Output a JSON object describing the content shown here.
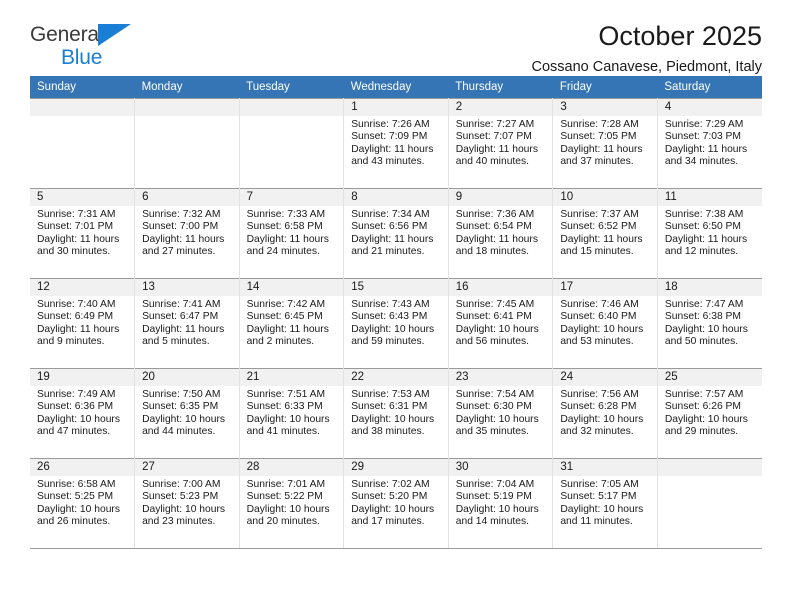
{
  "brand": {
    "name_line1": "General",
    "name_line2": "Blue",
    "accent_color": "#1a7fd4"
  },
  "header": {
    "title": "October 2025",
    "subtitle": "Cossano Canavese, Piedmont, Italy"
  },
  "calendar": {
    "header_bg": "#3575b5",
    "daynum_bg": "#f1f1f1",
    "weekdays": [
      "Sunday",
      "Monday",
      "Tuesday",
      "Wednesday",
      "Thursday",
      "Friday",
      "Saturday"
    ],
    "weeks": [
      [
        {
          "day": "",
          "empty": true
        },
        {
          "day": "",
          "empty": true
        },
        {
          "day": "",
          "empty": true
        },
        {
          "day": "1",
          "sunrise": "Sunrise: 7:26 AM",
          "sunset": "Sunset: 7:09 PM",
          "daylight1": "Daylight: 11 hours",
          "daylight2": "and 43 minutes."
        },
        {
          "day": "2",
          "sunrise": "Sunrise: 7:27 AM",
          "sunset": "Sunset: 7:07 PM",
          "daylight1": "Daylight: 11 hours",
          "daylight2": "and 40 minutes."
        },
        {
          "day": "3",
          "sunrise": "Sunrise: 7:28 AM",
          "sunset": "Sunset: 7:05 PM",
          "daylight1": "Daylight: 11 hours",
          "daylight2": "and 37 minutes."
        },
        {
          "day": "4",
          "sunrise": "Sunrise: 7:29 AM",
          "sunset": "Sunset: 7:03 PM",
          "daylight1": "Daylight: 11 hours",
          "daylight2": "and 34 minutes."
        }
      ],
      [
        {
          "day": "5",
          "sunrise": "Sunrise: 7:31 AM",
          "sunset": "Sunset: 7:01 PM",
          "daylight1": "Daylight: 11 hours",
          "daylight2": "and 30 minutes."
        },
        {
          "day": "6",
          "sunrise": "Sunrise: 7:32 AM",
          "sunset": "Sunset: 7:00 PM",
          "daylight1": "Daylight: 11 hours",
          "daylight2": "and 27 minutes."
        },
        {
          "day": "7",
          "sunrise": "Sunrise: 7:33 AM",
          "sunset": "Sunset: 6:58 PM",
          "daylight1": "Daylight: 11 hours",
          "daylight2": "and 24 minutes."
        },
        {
          "day": "8",
          "sunrise": "Sunrise: 7:34 AM",
          "sunset": "Sunset: 6:56 PM",
          "daylight1": "Daylight: 11 hours",
          "daylight2": "and 21 minutes."
        },
        {
          "day": "9",
          "sunrise": "Sunrise: 7:36 AM",
          "sunset": "Sunset: 6:54 PM",
          "daylight1": "Daylight: 11 hours",
          "daylight2": "and 18 minutes."
        },
        {
          "day": "10",
          "sunrise": "Sunrise: 7:37 AM",
          "sunset": "Sunset: 6:52 PM",
          "daylight1": "Daylight: 11 hours",
          "daylight2": "and 15 minutes."
        },
        {
          "day": "11",
          "sunrise": "Sunrise: 7:38 AM",
          "sunset": "Sunset: 6:50 PM",
          "daylight1": "Daylight: 11 hours",
          "daylight2": "and 12 minutes."
        }
      ],
      [
        {
          "day": "12",
          "sunrise": "Sunrise: 7:40 AM",
          "sunset": "Sunset: 6:49 PM",
          "daylight1": "Daylight: 11 hours",
          "daylight2": "and 9 minutes."
        },
        {
          "day": "13",
          "sunrise": "Sunrise: 7:41 AM",
          "sunset": "Sunset: 6:47 PM",
          "daylight1": "Daylight: 11 hours",
          "daylight2": "and 5 minutes."
        },
        {
          "day": "14",
          "sunrise": "Sunrise: 7:42 AM",
          "sunset": "Sunset: 6:45 PM",
          "daylight1": "Daylight: 11 hours",
          "daylight2": "and 2 minutes."
        },
        {
          "day": "15",
          "sunrise": "Sunrise: 7:43 AM",
          "sunset": "Sunset: 6:43 PM",
          "daylight1": "Daylight: 10 hours",
          "daylight2": "and 59 minutes."
        },
        {
          "day": "16",
          "sunrise": "Sunrise: 7:45 AM",
          "sunset": "Sunset: 6:41 PM",
          "daylight1": "Daylight: 10 hours",
          "daylight2": "and 56 minutes."
        },
        {
          "day": "17",
          "sunrise": "Sunrise: 7:46 AM",
          "sunset": "Sunset: 6:40 PM",
          "daylight1": "Daylight: 10 hours",
          "daylight2": "and 53 minutes."
        },
        {
          "day": "18",
          "sunrise": "Sunrise: 7:47 AM",
          "sunset": "Sunset: 6:38 PM",
          "daylight1": "Daylight: 10 hours",
          "daylight2": "and 50 minutes."
        }
      ],
      [
        {
          "day": "19",
          "sunrise": "Sunrise: 7:49 AM",
          "sunset": "Sunset: 6:36 PM",
          "daylight1": "Daylight: 10 hours",
          "daylight2": "and 47 minutes."
        },
        {
          "day": "20",
          "sunrise": "Sunrise: 7:50 AM",
          "sunset": "Sunset: 6:35 PM",
          "daylight1": "Daylight: 10 hours",
          "daylight2": "and 44 minutes."
        },
        {
          "day": "21",
          "sunrise": "Sunrise: 7:51 AM",
          "sunset": "Sunset: 6:33 PM",
          "daylight1": "Daylight: 10 hours",
          "daylight2": "and 41 minutes."
        },
        {
          "day": "22",
          "sunrise": "Sunrise: 7:53 AM",
          "sunset": "Sunset: 6:31 PM",
          "daylight1": "Daylight: 10 hours",
          "daylight2": "and 38 minutes."
        },
        {
          "day": "23",
          "sunrise": "Sunrise: 7:54 AM",
          "sunset": "Sunset: 6:30 PM",
          "daylight1": "Daylight: 10 hours",
          "daylight2": "and 35 minutes."
        },
        {
          "day": "24",
          "sunrise": "Sunrise: 7:56 AM",
          "sunset": "Sunset: 6:28 PM",
          "daylight1": "Daylight: 10 hours",
          "daylight2": "and 32 minutes."
        },
        {
          "day": "25",
          "sunrise": "Sunrise: 7:57 AM",
          "sunset": "Sunset: 6:26 PM",
          "daylight1": "Daylight: 10 hours",
          "daylight2": "and 29 minutes."
        }
      ],
      [
        {
          "day": "26",
          "sunrise": "Sunrise: 6:58 AM",
          "sunset": "Sunset: 5:25 PM",
          "daylight1": "Daylight: 10 hours",
          "daylight2": "and 26 minutes."
        },
        {
          "day": "27",
          "sunrise": "Sunrise: 7:00 AM",
          "sunset": "Sunset: 5:23 PM",
          "daylight1": "Daylight: 10 hours",
          "daylight2": "and 23 minutes."
        },
        {
          "day": "28",
          "sunrise": "Sunrise: 7:01 AM",
          "sunset": "Sunset: 5:22 PM",
          "daylight1": "Daylight: 10 hours",
          "daylight2": "and 20 minutes."
        },
        {
          "day": "29",
          "sunrise": "Sunrise: 7:02 AM",
          "sunset": "Sunset: 5:20 PM",
          "daylight1": "Daylight: 10 hours",
          "daylight2": "and 17 minutes."
        },
        {
          "day": "30",
          "sunrise": "Sunrise: 7:04 AM",
          "sunset": "Sunset: 5:19 PM",
          "daylight1": "Daylight: 10 hours",
          "daylight2": "and 14 minutes."
        },
        {
          "day": "31",
          "sunrise": "Sunrise: 7:05 AM",
          "sunset": "Sunset: 5:17 PM",
          "daylight1": "Daylight: 10 hours",
          "daylight2": "and 11 minutes."
        },
        {
          "day": "",
          "empty": true
        }
      ]
    ]
  }
}
